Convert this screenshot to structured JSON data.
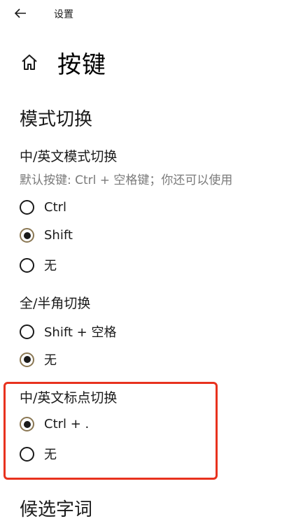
{
  "window": {
    "title": "设置"
  },
  "page": {
    "title": "按键"
  },
  "section": {
    "title": "模式切换"
  },
  "groups": [
    {
      "label": "中/英文模式切换",
      "hint": "默认按键: Ctrl + 空格键；你还可以使用",
      "options": [
        {
          "label": "Ctrl",
          "checked": false
        },
        {
          "label": "Shift",
          "checked": true
        },
        {
          "label": "无",
          "checked": false
        }
      ]
    },
    {
      "label": "全/半角切换",
      "options": [
        {
          "label": "Shift + 空格",
          "checked": false
        },
        {
          "label": "无",
          "checked": true
        }
      ]
    },
    {
      "label": "中/英文标点切换",
      "options": [
        {
          "label": "Ctrl + .",
          "checked": true
        },
        {
          "label": "无",
          "checked": false
        }
      ]
    }
  ],
  "next_section": {
    "title": "候选字词"
  },
  "colors": {
    "highlight": "#e8321e",
    "radio_ring_checked": "#8a7753",
    "hint_text": "#7a7a7a"
  }
}
